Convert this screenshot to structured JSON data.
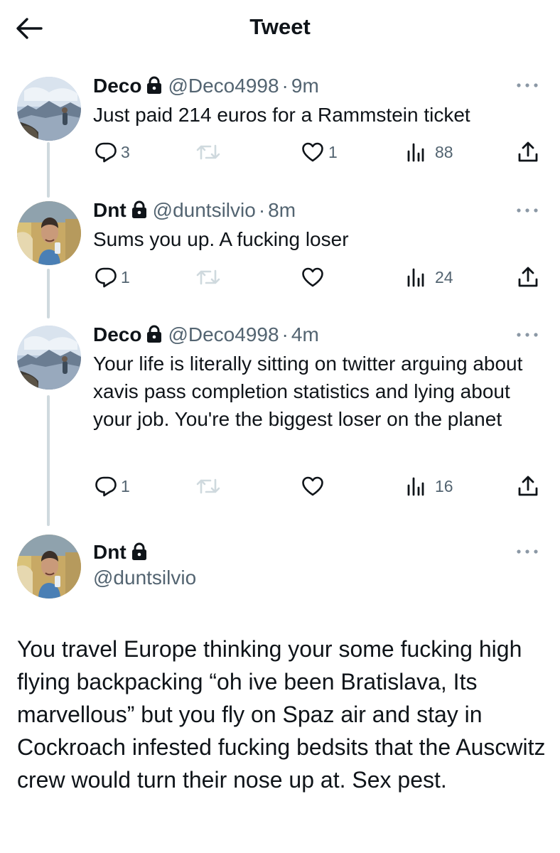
{
  "header": {
    "title": "Tweet",
    "back_icon": "arrow-left-icon"
  },
  "colors": {
    "text": "#0f1419",
    "secondary": "#536471",
    "thread_line": "#cfd9de"
  },
  "tweets": [
    {
      "name": "Deco",
      "handle": "@Deco4998",
      "separator": "·",
      "time": "9m",
      "text": "Just paid 214 euros for a Rammstein ticket",
      "replies": "3",
      "retweets": "",
      "likes": "1",
      "views": "88"
    },
    {
      "name": "Dnt",
      "handle": "@duntsilvio",
      "separator": "·",
      "time": "8m",
      "text": "Sums you up. A fucking loser",
      "replies": "1",
      "retweets": "",
      "likes": "",
      "views": "24"
    },
    {
      "name": "Deco",
      "handle": "@Deco4998",
      "separator": "·",
      "time": "4m",
      "text": "Your life is literally sitting on twitter arguing about xavis pass completion statistics and lying about your job. You're the biggest loser on the planet",
      "replies": "1",
      "retweets": "",
      "likes": "",
      "views": "16"
    }
  ],
  "main_tweet": {
    "name": "Dnt",
    "handle": "@duntsilvio",
    "text": "You travel Europe thinking your some fucking high flying backpacking “oh ive been Bratislava, Its marvellous” but you fly on Spaz air and stay in Cockroach infested fucking bedsits that the Auscwitz crew would turn their nose up at. Sex pest."
  }
}
